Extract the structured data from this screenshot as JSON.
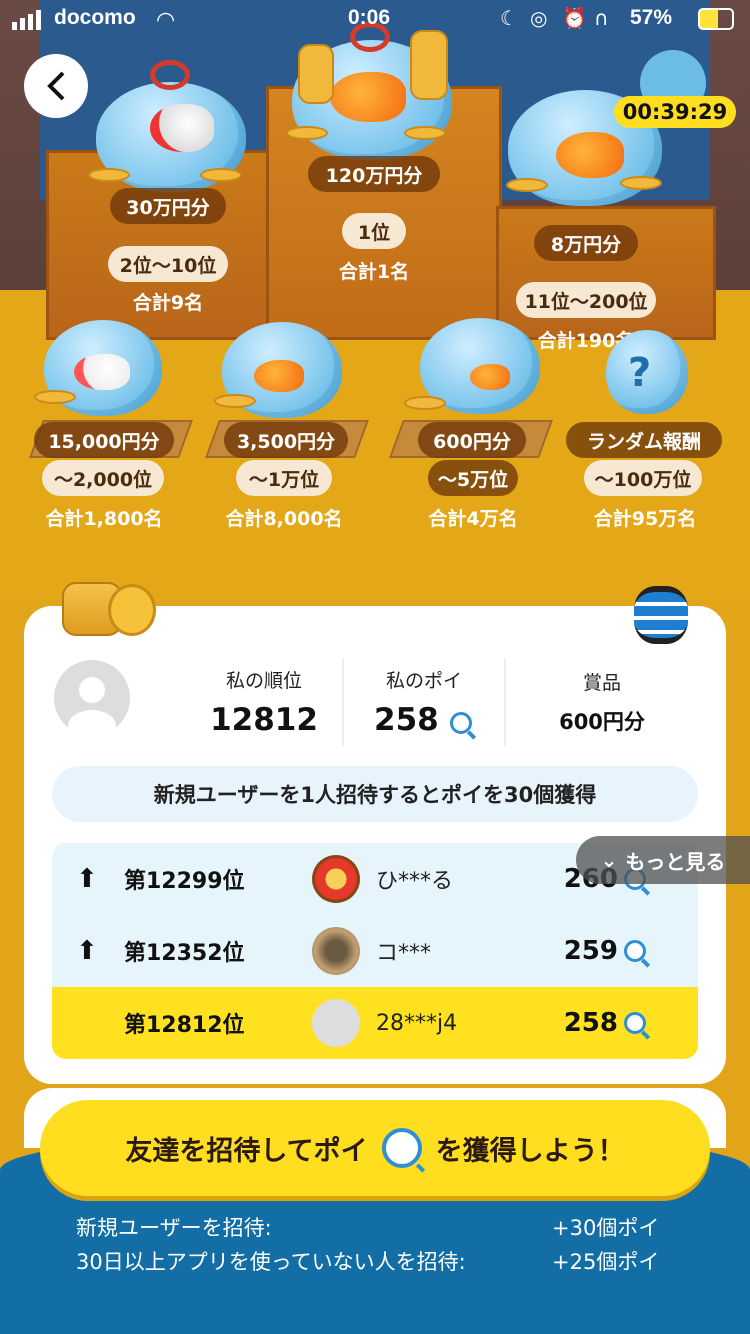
{
  "status_bar": {
    "carrier": "docomo",
    "time": "0:06",
    "battery": "57%"
  },
  "timer": "00:39:29",
  "prizes": [
    {
      "amount": "120万円分",
      "rank": "1位",
      "total": "合計1名"
    },
    {
      "amount": "30万円分",
      "rank": "2位〜10位",
      "total": "合計9名"
    },
    {
      "amount": "8万円分",
      "rank": "11位〜200位",
      "total": "合計190名"
    },
    {
      "amount": "15,000円分",
      "rank": "〜2,000位",
      "total": "合計1,800名"
    },
    {
      "amount": "3,500円分",
      "rank": "〜1万位",
      "total": "合計8,000名"
    },
    {
      "amount": "600円分",
      "rank": "〜5万位",
      "total": "合計4万名"
    },
    {
      "amount": "ランダム報酬",
      "rank": "〜100万位",
      "total": "合計95万名"
    }
  ],
  "stats": {
    "rank_label": "私の順位",
    "rank_value": "12812",
    "poi_label": "私のポイ",
    "poi_value": "258",
    "prize_label": "賞品",
    "prize_value": "600円分"
  },
  "invite_banner": "新規ユーザーを1人招待するとポイを30個獲得",
  "more_label": "もっと見る",
  "ranking": [
    {
      "rank": "第12299位",
      "name": "ひ***る",
      "points": "260"
    },
    {
      "rank": "第12352位",
      "name": "コ***",
      "points": "259"
    },
    {
      "rank": "第12812位",
      "name": "28***j4",
      "points": "258"
    }
  ],
  "cta": {
    "left": "友達を招待してポイ",
    "right": "を獲得しよう！"
  },
  "rewards": [
    {
      "label": "新規ユーザーを招待:",
      "value": "+30個ポイ"
    },
    {
      "label": "30日以上アプリを使っていない人を招待:",
      "value": "+25個ポイ"
    }
  ],
  "colors": {
    "accent_yellow": "#ffde1f",
    "bottom_blue": "#126ea4",
    "highlight_row": "#ffe11f",
    "light_row": "#e6f4fc"
  }
}
